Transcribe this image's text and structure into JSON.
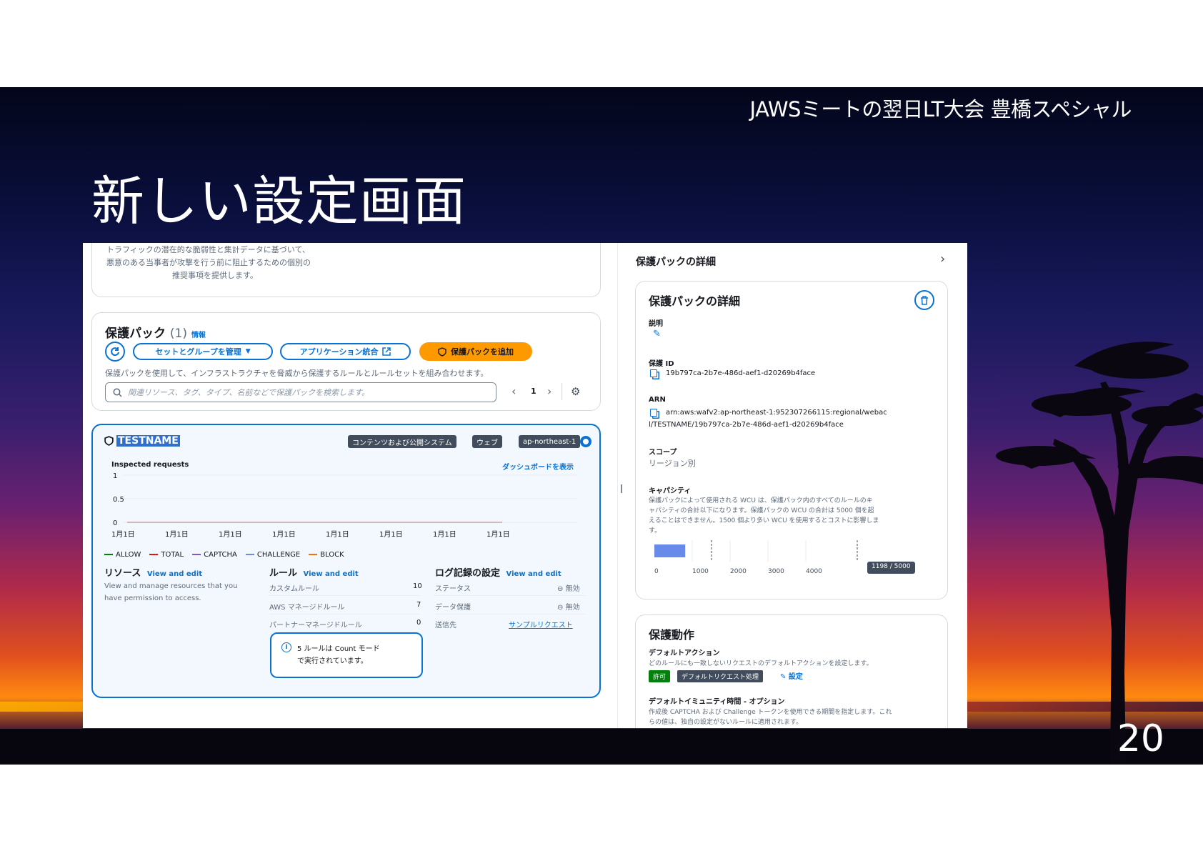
{
  "slide": {
    "event_title": "JAWSミートの翌日LT大会 豊橋スペシャル",
    "title": "新しい設定画面",
    "page_number": "20"
  },
  "left": {
    "intro_line1": "トラフィックの潜在的な脆弱性と集計データに基づいて、",
    "intro_line2": "悪意のある当事者が攻撃を行う前に阻止するための個別の",
    "intro_line3": "推奨事項を提供します。",
    "packs": {
      "title": "保護パック",
      "count": "(1)",
      "info_link": "情報",
      "manage_btn": "セットとグループを管理",
      "app_btn": "アプリケーション統合",
      "add_btn": "保護パックを追加",
      "description": "保護パックを使用して、インフラストラクチャを脅威から保護するルールとルールセットを組み合わせます。",
      "search_placeholder": "関連リソース、タグ、タイプ、名前などで保護パックを検索します。",
      "page": "1"
    },
    "testname_card": {
      "name": "TESTNAME",
      "tags": [
        "コンテンツおよび公開システム",
        "ウェブ",
        "ap-northeast-1"
      ],
      "chart_label": "Inspected requests",
      "dashboard_link": "ダッシュボードを表示",
      "legend": [
        {
          "label": "ALLOW",
          "color": "#037f0c"
        },
        {
          "label": "TOTAL",
          "color": "#d91515"
        },
        {
          "label": "CAPTCHA",
          "color": "#8456ce"
        },
        {
          "label": "CHALLENGE",
          "color": "#688ae8"
        },
        {
          "label": "BLOCK",
          "color": "#ec7211"
        }
      ],
      "resources": {
        "title": "リソース",
        "link": "View and edit",
        "desc_line1": "View and manage resources that you",
        "desc_line2": "have permission to access."
      },
      "rules": {
        "title": "ルール",
        "link": "View and edit",
        "rows": [
          {
            "label": "カスタムルール",
            "value": "10"
          },
          {
            "label": "AWS マネージドルール",
            "value": "7"
          },
          {
            "label": "パートナーマネージドルール",
            "value": "0"
          }
        ],
        "note_line1": "5 ルールは Count モード",
        "note_line2": "で実行されています。"
      },
      "logging": {
        "title": "ログ記録の設定",
        "link": "View and edit",
        "rows": [
          {
            "label": "ステータス",
            "value": "無効"
          },
          {
            "label": "データ保護",
            "value": "無効"
          },
          {
            "label": "送信先",
            "value": "サンプルリクエスト"
          }
        ]
      }
    }
  },
  "chart_data": {
    "type": "line",
    "title": "Inspected requests",
    "categories": [
      "1月1日",
      "1月1日",
      "1月1日",
      "1月1日",
      "1月1日",
      "1月1日",
      "1月1日",
      "1月1日"
    ],
    "y_ticks": [
      "1",
      "0.5",
      "0"
    ],
    "ylim": [
      0,
      1
    ],
    "series": [
      {
        "name": "ALLOW",
        "values": [
          0,
          0,
          0,
          0,
          0,
          0,
          0,
          0
        ]
      },
      {
        "name": "TOTAL",
        "values": [
          0,
          0,
          0,
          0,
          0,
          0,
          0,
          0
        ]
      },
      {
        "name": "CAPTCHA",
        "values": [
          0,
          0,
          0,
          0,
          0,
          0,
          0,
          0
        ]
      },
      {
        "name": "CHALLENGE",
        "values": [
          0,
          0,
          0,
          0,
          0,
          0,
          0,
          0
        ]
      },
      {
        "name": "BLOCK",
        "values": [
          0,
          0,
          0,
          0,
          0,
          0,
          0,
          0
        ]
      }
    ],
    "grid": true,
    "legend": "bottom-left"
  },
  "right": {
    "header": "保護パックの詳細",
    "details": {
      "title": "保護パックの詳細",
      "desc_label": "説明",
      "id_label": "保護 ID",
      "id_value": "19b797ca-2b7e-486d-aef1-d20269b4face",
      "arn_label": "ARN",
      "arn_line1": "arn:aws:wafv2:ap-northeast-1:952307266115:regional/webac",
      "arn_line2": "l/TESTNAME/19b797ca-2b7e-486d-aef1-d20269b4face",
      "scope_label": "スコープ",
      "scope_value": "リージョン別",
      "capacity_label": "キャパシティ",
      "capacity_line1": "保護パックによって使用される WCU は、保護パック内のすべてのルールのキ",
      "capacity_line2": "ャパシティの合計以下になります。保護パックの WCU の合計は 5000 個を超",
      "capacity_line3": "えることはできません。1500 個より多い WCU を使用するとコストに影響しま",
      "capacity_line4": "す。",
      "capacity_ticks": [
        "0",
        "1000",
        "2000",
        "3000",
        "4000"
      ],
      "capacity_badge": "1198 / 5000",
      "capacity_used": 1198,
      "capacity_max": 5000
    },
    "action": {
      "title": "保護動作",
      "default_action_label": "デフォルトアクション",
      "default_action_desc": "どのルールにも一致しないリクエストのデフォルトアクションを設定します。",
      "allow_badge": "許可",
      "request_badge": "デフォルトリクエスト処理",
      "edit_link": "設定",
      "immunity_label": "デフォルトイミュニティ時間 - オプション",
      "immunity_desc1": "作成後 CAPTCHA および Challenge トークンを使用できる期間を指定します。これ",
      "immunity_desc2": "らの値は、独自の設定がないルールに適用されます。"
    }
  },
  "colors": {
    "accent": "#0972d3",
    "primary": "#ff9900",
    "selected_border": "#0972d3",
    "selected_bg": "#f2f8fd",
    "allow_green": "#037f0c"
  }
}
